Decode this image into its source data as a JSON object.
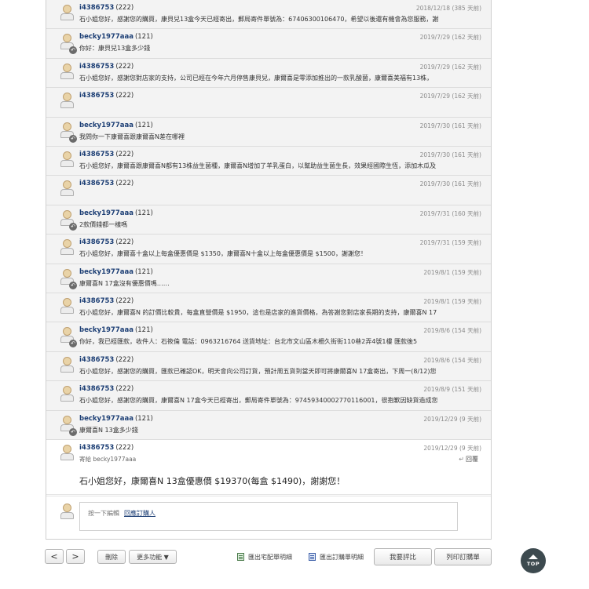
{
  "messages": [
    {
      "author": "i4386753",
      "num": "(222)",
      "date": "2018/12/18 (385 天前)",
      "text": "石小姐您好，感謝您的購買，康貝兒13盒今天已經寄出，郵局寄件單號為：67406300106470，希望以後還有機會為您服務，謝",
      "reply": false
    },
    {
      "author": "becky1977aaa",
      "num": "(121)",
      "date": "2019/7/29 (162 天前)",
      "text": "你好：康貝兒13盒多少錢",
      "reply": true
    },
    {
      "author": "i4386753",
      "num": "(222)",
      "date": "2019/7/29 (162 天前)",
      "text": "石小姐您好，感謝您對店家的支持，公司已經在今年六月停售康貝兒，康爾喜是零添加推出的一款乳酸菌，康爾喜美福有13株，",
      "reply": false
    },
    {
      "author": "i4386753",
      "num": "(222)",
      "date": "2019/7/29 (162 天前)",
      "text": "",
      "reply": false
    },
    {
      "author": "becky1977aaa",
      "num": "(121)",
      "date": "2019/7/30 (161 天前)",
      "text": "我問你一下康爾喜跟康爾喜N差在哪裡",
      "reply": true
    },
    {
      "author": "i4386753",
      "num": "(222)",
      "date": "2019/7/30 (161 天前)",
      "text": "石小姐您好，康爾喜跟康爾喜N都有13株益生菌種，康爾喜N增加了羊乳蛋白，以幫助益生菌生長，效果經國際生恆，添加木瓜及",
      "reply": false
    },
    {
      "author": "i4386753",
      "num": "(222)",
      "date": "2019/7/30 (161 天前)",
      "text": "",
      "reply": false
    },
    {
      "author": "becky1977aaa",
      "num": "(121)",
      "date": "2019/7/31 (160 天前)",
      "text": "2款價錢都一樣嗎",
      "reply": true
    },
    {
      "author": "i4386753",
      "num": "(222)",
      "date": "2019/7/31 (159 天前)",
      "text": "石小姐您好，康爾喜十盒以上每盒優惠價是 $1350，康爾喜N十盒以上每盒優惠價是 $1500，謝謝您！",
      "reply": false
    },
    {
      "author": "becky1977aaa",
      "num": "(121)",
      "date": "2019/8/1 (159 天前)",
      "text": "康爾喜N 17盒沒有優惠價嗎……",
      "reply": true
    },
    {
      "author": "i4386753",
      "num": "(222)",
      "date": "2019/8/1 (159 天前)",
      "text": "石小姐您好，康爾喜N 的訂價比較貴，每盒直營價是 $1950，這也是店家的進貨價格，為答謝您對店家長期的支持，康爾喜N 17",
      "reply": false
    },
    {
      "author": "becky1977aaa",
      "num": "(121)",
      "date": "2019/8/6 (154 天前)",
      "text": "你好，我已經匯款，收件人：石筱倫 電話：0963216764 送貨地址：台北市文山區木柵久街街110巷2弄4號1樓 匯款後5",
      "reply": true
    },
    {
      "author": "i4386753",
      "num": "(222)",
      "date": "2019/8/6 (154 天前)",
      "text": "石小姐您好，感謝您的購買，匯款已確認OK，明天會向公司訂貨，預計周五貨到當天即可將康爾喜N 17盒寄出，下周一(8/12)您",
      "reply": false
    },
    {
      "author": "i4386753",
      "num": "(222)",
      "date": "2019/8/9 (151 天前)",
      "text": "石小姐您好，感謝您的購買，康爾喜N 17盒今天已經寄出，郵局寄件單號為：97459340002770116001，很抱歉因缺貨造成您",
      "reply": false
    },
    {
      "author": "becky1977aaa",
      "num": "(121)",
      "date": "2019/12/29 (9 天前)",
      "text": "康爾喜N 13盒多少錢",
      "reply": true
    }
  ],
  "last_message": {
    "author": "i4386753",
    "num": "(222)",
    "date": "2019/12/29 (9 天前)",
    "send_to": "寄給 becky1977aaa",
    "reply_label": "回覆",
    "text": "石小姐您好，康爾喜N 13盒優惠價 $19370(每盒 $1490)，謝謝您！"
  },
  "reply_box": {
    "hint": "按一下編輯",
    "link": "回應訂購人"
  },
  "toolbar": {
    "prev": "<",
    "next": ">",
    "delete": "刪除",
    "more": "更多功能 ▼",
    "print_delivery": "匯出宅配單明細",
    "print_order": "匯出訂購單明細",
    "rate": "我要評比",
    "print_order_list": "列印訂購單"
  },
  "top_button": "TOP"
}
